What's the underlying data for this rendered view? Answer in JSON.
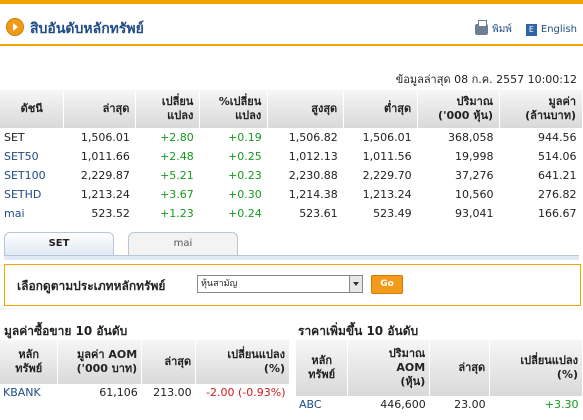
{
  "header": {
    "title": "สิบอันดับหลักทรัพย์",
    "print_label": "พิมพ์",
    "english_label": "English",
    "english_icon_glyph": "E"
  },
  "updated": "ข้อมูลล่าสุด 08 ก.ค. 2557 10:00:12",
  "index_table": {
    "headers": [
      [
        "ดัชนี"
      ],
      [
        "ล่าสุด"
      ],
      [
        "เปลี่ยน",
        "แปลง"
      ],
      [
        "%เปลี่ยน",
        "แปลง"
      ],
      [
        "สูงสุด"
      ],
      [
        "ต่ำสุด"
      ],
      [
        "ปริมาณ",
        "('000 หุ้น)"
      ],
      [
        "มูลค่า",
        "(ล้านบาท)"
      ]
    ],
    "rows": [
      [
        "SET",
        "1,506.01",
        "+2.80",
        "+0.19",
        "1,506.82",
        "1,506.01",
        "368,058",
        "944.56"
      ],
      [
        "SET50",
        "1,011.66",
        "+2.48",
        "+0.25",
        "1,012.13",
        "1,011.56",
        "19,998",
        "514.06"
      ],
      [
        "SET100",
        "2,229.87",
        "+5.21",
        "+0.23",
        "2,230.88",
        "2,229.70",
        "37,276",
        "641.21"
      ],
      [
        "SETHD",
        "1,213.24",
        "+3.67",
        "+0.30",
        "1,214.38",
        "1,213.24",
        "10,560",
        "276.82"
      ],
      [
        "mai",
        "523.52",
        "+1.23",
        "+0.24",
        "523.61",
        "523.49",
        "93,041",
        "166.67"
      ]
    ]
  },
  "tabs": [
    "SET",
    "mai"
  ],
  "filter": {
    "label": "เลือกดูตามประเภทหลักทรัพย์",
    "selected": "หุ้นสามัญ",
    "go_label": "Go"
  },
  "left_table": {
    "title": "มูลค่าซื้อขาย 10 อันดับ",
    "headers": [
      [
        "หลัก",
        "ทรัพย์"
      ],
      [
        "มูลค่า AOM",
        "('000 บาท)"
      ],
      [
        "ล่าสุด"
      ],
      [
        "เปลี่ยนแปลง",
        "(%)"
      ]
    ],
    "rows": [
      [
        "KBANK",
        "61,106",
        "213.00",
        "-2.00 (-0.93%)"
      ]
    ]
  },
  "right_table": {
    "title": "ราคาเพิ่มขึ้น 10 อันดับ",
    "headers": [
      [
        "หลัก",
        "ทรัพย์"
      ],
      [
        "ปริมาณ",
        "AOM",
        "(หุ้น)"
      ],
      [
        "ล่าสุด"
      ],
      [
        "เปลี่ยนแปลง",
        "(%)"
      ]
    ],
    "rows": [
      [
        "ABC",
        "446,600",
        "23.00",
        "+3.30"
      ]
    ]
  }
}
